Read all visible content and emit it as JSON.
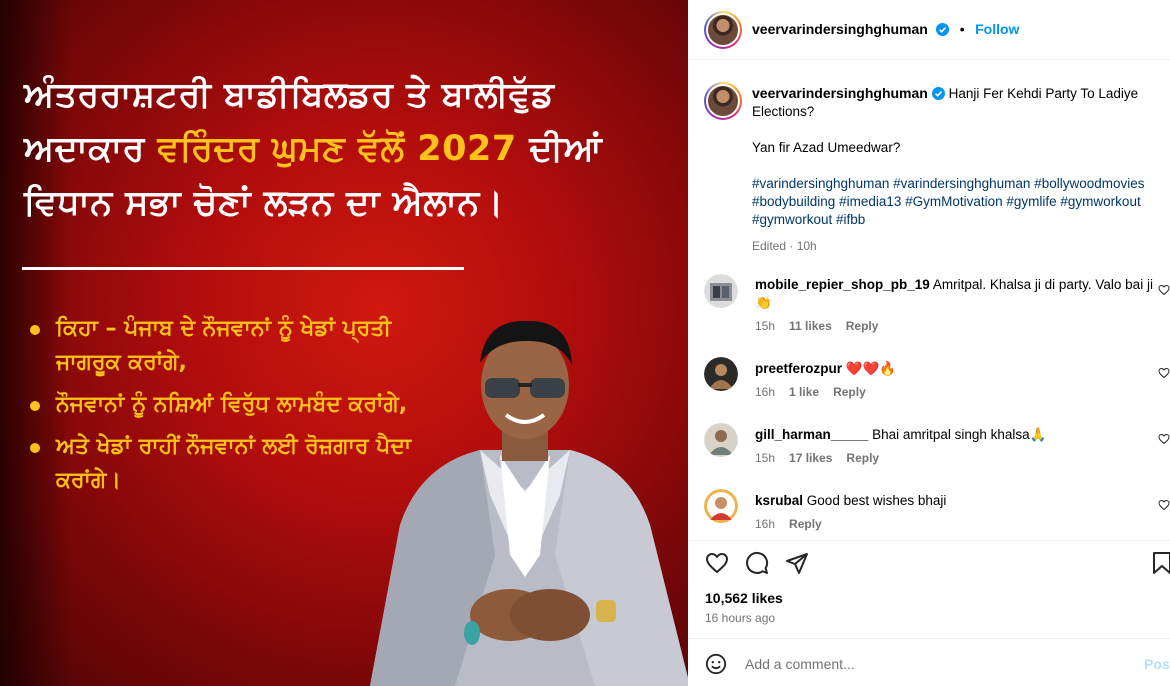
{
  "post_image": {
    "headline_part1": "ਅੰਤਰਰਾਸ਼ਟਰੀ ਬਾਡੀਬਿਲਡਰ ਤੇ ਬਾਲੀਵੁੱਡ ਅਦਾਕਾਰ ",
    "headline_highlight": "ਵਰਿੰਦਰ ਘੁਮਣ ਵੱਲੋਂ 2027",
    "headline_part2": " ਦੀਆਂ ਵਿਧਾਨ ਸਭਾ ਚੋਣਾਂ ਲੜਨ ਦਾ ਐਲਾਨ।",
    "bullets": [
      "ਕਿਹਾ – ਪੰਜਾਬ ਦੇ ਨੌਜਵਾਨਾਂ ਨੂੰ ਖੇਡਾਂ ਪ੍ਰਤੀ ਜਾਗਰੂਕ ਕਰਾਂਗੇ,",
      "ਨੌਜਵਾਨਾਂ ਨੂੰ ਨਸ਼ਿਆਂ ਵਿਰੁੱਧ ਲਾਮਬੰਦ ਕਰਾਂਗੇ,",
      "ਅਤੇ ਖੇਡਾਂ ਰਾਹੀਂ ਨੌਜਵਾਨਾਂ ਲਈ ਰੋਜ਼ਗਾਰ ਪੈਦਾ ਕਰਾਂਗੇ।"
    ],
    "colors": {
      "background": "#b10d0c",
      "highlight": "#ffc21a",
      "text": "#ffffff"
    }
  },
  "header": {
    "username": "veervarindersinghghuman",
    "separator": "•",
    "follow_label": "Follow"
  },
  "caption": {
    "username": "veervarindersinghghuman",
    "line1": "Hanji Fer Kehdi Party To Ladiye Elections?",
    "line2": "Yan fir Azad Umeedwar?",
    "hashtags": "#varindersinghghuman #varindersinghghuman #bollywoodmovies #bodybuilding #imedia13 #GymMotivation #gymlife #gymworkout #gymworkout #ifbb",
    "meta": "Edited · 10h"
  },
  "comments": [
    {
      "username": "mobile_repier_shop_pb_19",
      "text": "Amritpal. Khalsa ji di party. Valo bai ji👏",
      "time": "15h",
      "likes": "11 likes",
      "reply": "Reply"
    },
    {
      "username": "preetferozpur",
      "text": "❤️❤️🔥",
      "time": "16h",
      "likes": "1 like",
      "reply": "Reply"
    },
    {
      "username": "gill_harman_____",
      "text": "Bhai amritpal singh khalsa🙏",
      "time": "15h",
      "likes": "17 likes",
      "reply": "Reply"
    },
    {
      "username": "ksrubal",
      "text": "Good best wishes bhaji",
      "time": "16h",
      "likes": "",
      "reply": "Reply"
    }
  ],
  "stats": {
    "likes": "10,562 likes",
    "ago": "16 hours ago"
  },
  "add_comment": {
    "placeholder": "Add a comment...",
    "post_label": "Post"
  },
  "colors": {
    "link": "#0095f6",
    "hashtag": "#00376b",
    "muted": "#737373"
  }
}
